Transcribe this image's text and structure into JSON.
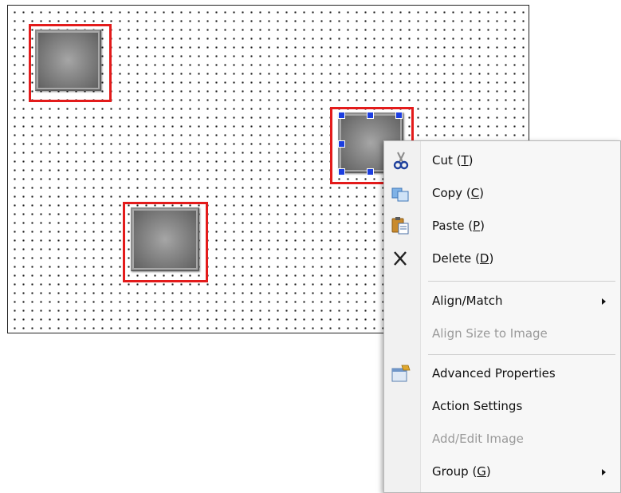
{
  "menu": {
    "items": [
      {
        "label": "Cut",
        "accel": "T",
        "icon": "cut-icon",
        "enabled": true
      },
      {
        "label": "Copy",
        "accel": "C",
        "icon": "copy-icon",
        "enabled": true
      },
      {
        "label": "Paste",
        "accel": "P",
        "icon": "paste-icon",
        "enabled": true
      },
      {
        "label": "Delete",
        "accel": "D",
        "icon": "delete-icon",
        "enabled": true
      },
      {
        "label": "Align/Match",
        "submenu": true,
        "enabled": true
      },
      {
        "label": "Align Size to Image",
        "enabled": false
      },
      {
        "label": "Advanced Properties",
        "icon": "advanced-properties-icon",
        "enabled": true
      },
      {
        "label": "Action Settings",
        "enabled": true
      },
      {
        "label": "Add/Edit Image",
        "enabled": false
      },
      {
        "label": "Group",
        "accel": "G",
        "submenu": true,
        "enabled": true
      }
    ]
  },
  "colors": {
    "selection": "#e31b1b",
    "handle": "#1c3ee0",
    "disabled_text": "#9a9a9a"
  }
}
